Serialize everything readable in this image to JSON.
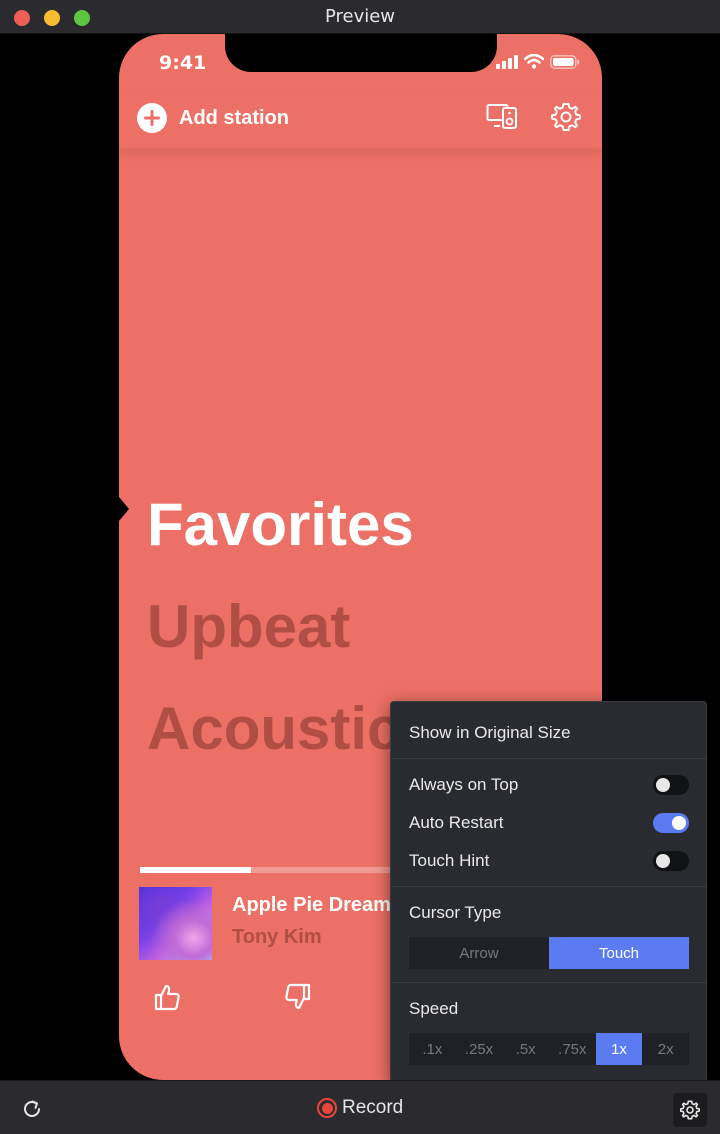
{
  "window": {
    "title": "Preview"
  },
  "phone": {
    "status_time": "9:41",
    "add_station_label": "Add station",
    "stations": [
      "Favorites",
      "Upbeat",
      "Acoustic"
    ],
    "active_station": "Favorites",
    "now_playing": {
      "title": "Apple Pie Dream",
      "artist": "Tony Kim",
      "progress_fraction": 0.37
    },
    "colors": {
      "background": "#ec7065",
      "active_text": "#ffffff",
      "dim_text": "#b04e46"
    }
  },
  "settings_menu": {
    "show_original_size": "Show in Original Size",
    "toggles": [
      {
        "label": "Always on Top",
        "on": false
      },
      {
        "label": "Auto Restart",
        "on": true
      },
      {
        "label": "Touch Hint",
        "on": false
      }
    ],
    "cursor_type": {
      "label": "Cursor Type",
      "options": [
        "Arrow",
        "Touch"
      ],
      "selected": "Touch"
    },
    "speed": {
      "label": "Speed",
      "options": [
        ".1x",
        ".25x",
        ".5x",
        ".75x",
        "1x",
        "2x"
      ],
      "selected": "1x"
    },
    "accent": "#5b7cf0"
  },
  "toolbar": {
    "record_label": "Record"
  },
  "icons": [
    "reload-icon",
    "record-icon",
    "gear-icon",
    "plus-circle-icon",
    "device-speaker-icon",
    "thumbs-up-icon",
    "thumbs-down-icon",
    "signal-icon",
    "wifi-icon",
    "battery-icon"
  ]
}
